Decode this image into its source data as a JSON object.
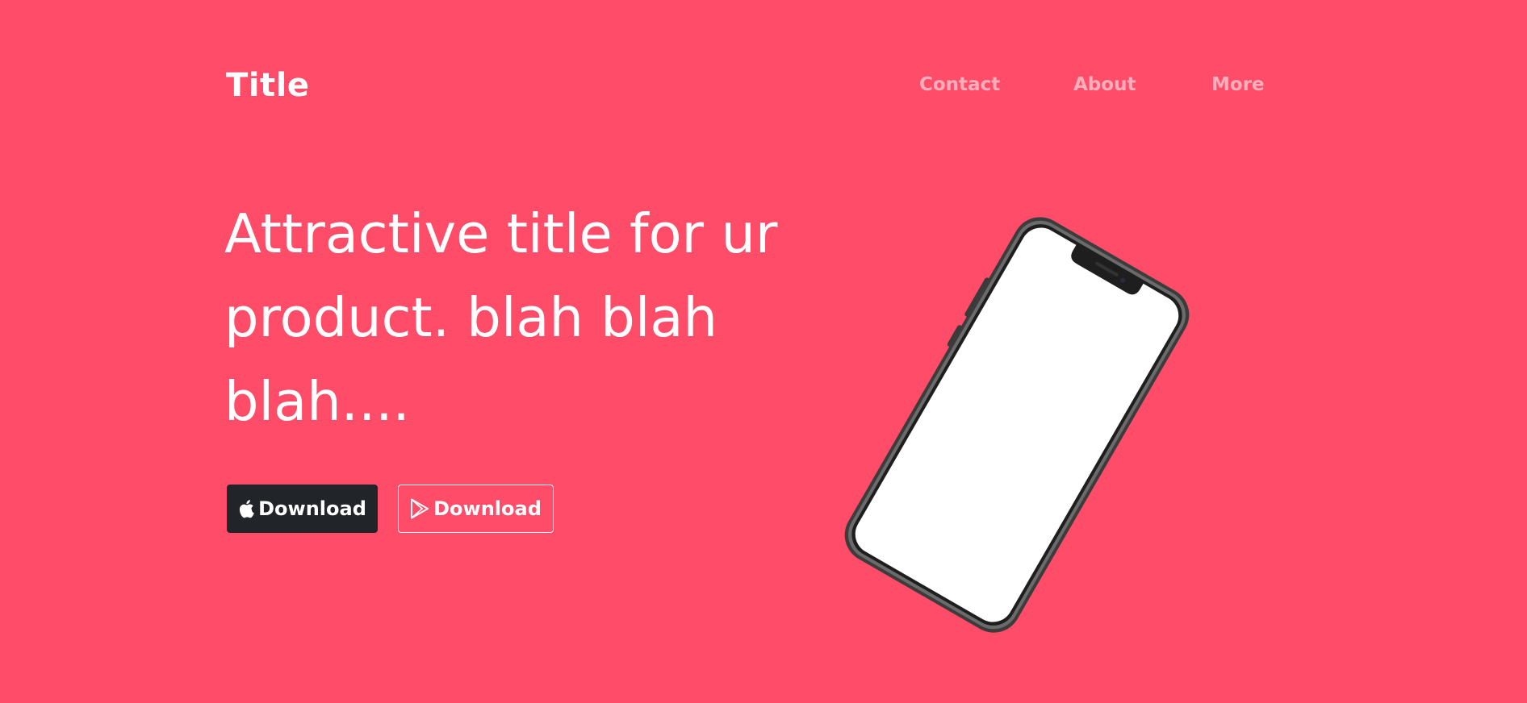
{
  "header": {
    "brand": "Title",
    "nav": [
      "Contact",
      "About",
      "More"
    ]
  },
  "hero": {
    "title": "Attractive title for ur product. blah blah blah....",
    "buttons": [
      {
        "label": "Download",
        "icon": "apple-icon"
      },
      {
        "label": "Download",
        "icon": "google-play-icon"
      }
    ]
  },
  "colors": {
    "background": "#ff4c68",
    "dark_button": "#212529",
    "text": "#ffffff"
  }
}
